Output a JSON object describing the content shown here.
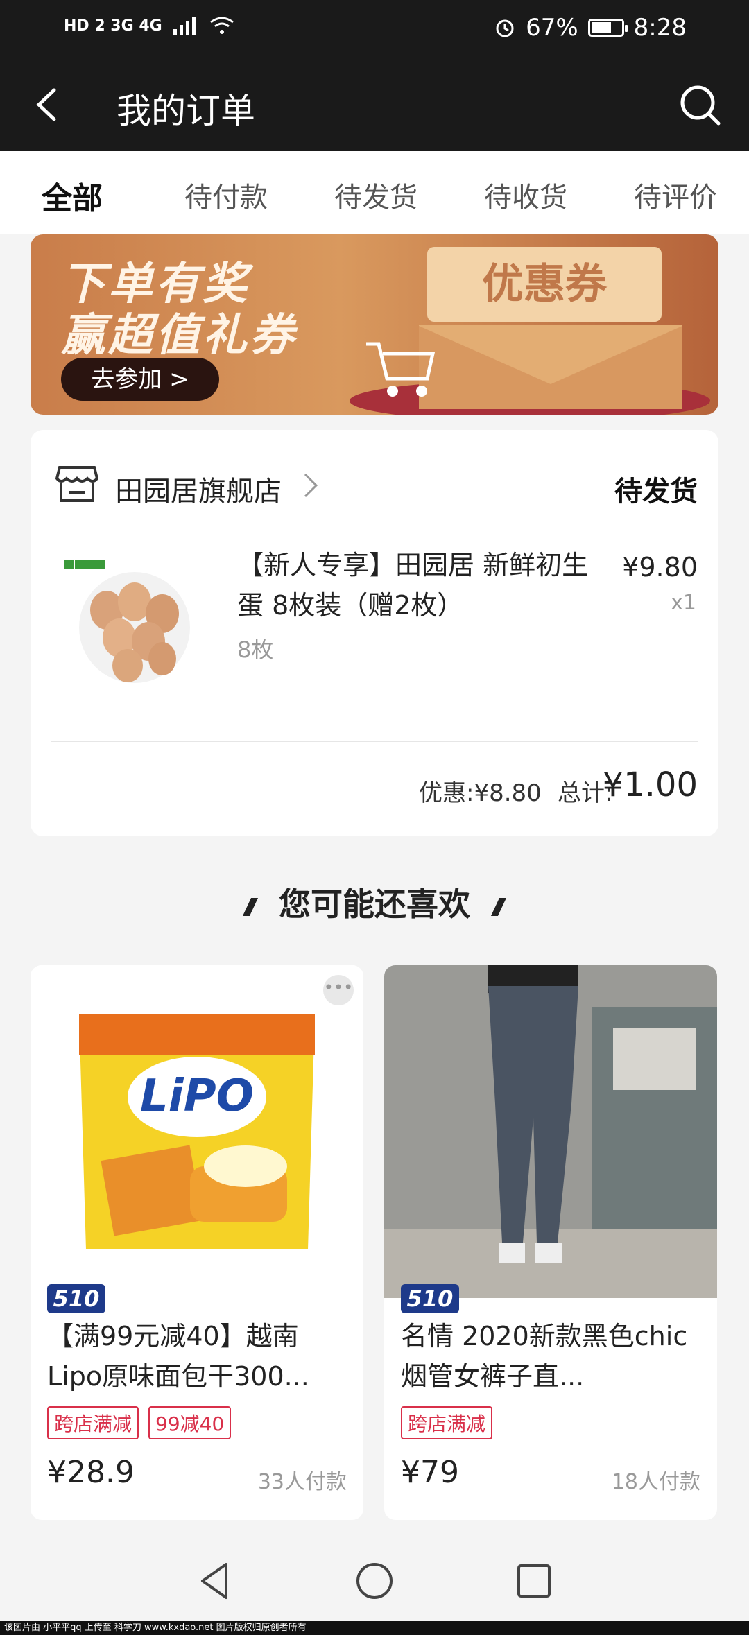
{
  "status_bar": {
    "network_left": "HD 2 3G 4G",
    "battery": "67%",
    "battery_level": 0.67,
    "time": "8:28"
  },
  "header": {
    "title": "我的订单"
  },
  "tabs": [
    {
      "label": "全部",
      "active": true
    },
    {
      "label": "待付款"
    },
    {
      "label": "待发货"
    },
    {
      "label": "待收货"
    },
    {
      "label": "待评价"
    }
  ],
  "banner": {
    "line1": "下单有奖",
    "line2": "赢超值礼券",
    "join_button": "去参加 >",
    "coupon_text": "优惠券"
  },
  "order": {
    "shop_name": "田园居旗舰店",
    "status": "待发货",
    "product_title": "【新人专享】田园居 新鲜初生蛋 8枚装（赠2枚）",
    "spec": "8枚",
    "price": "¥9.80",
    "qty": "x1",
    "discount": "优惠:¥8.80",
    "total_label": "总计:",
    "total_value": "¥1.00"
  },
  "recommend": {
    "heading": "您可能还喜欢",
    "items": [
      {
        "badge": "510",
        "name": "【满99元减40】越南Lipo原味面包干300...",
        "tags": [
          "跨店满减",
          "99减40"
        ],
        "price": "¥28.9",
        "sold": "33人付款"
      },
      {
        "badge": "510",
        "name": "名情 2020新款黑色chic烟管女裤子直...",
        "tags": [
          "跨店满减"
        ],
        "price": "¥79",
        "sold": "18人付款"
      }
    ]
  },
  "footer_credit": "该图片由 小平平qq 上传至 科学刀 www.kxdao.net 图片版权归原创者所有",
  "colors": {
    "header_bg": "#1a1a1a",
    "tag_red": "#d9304a",
    "badge_blue": "#1e3a8a"
  }
}
